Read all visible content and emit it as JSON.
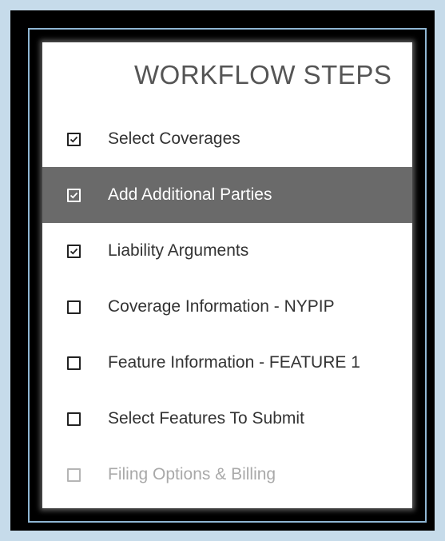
{
  "panel": {
    "title": "WORKFLOW STEPS"
  },
  "steps": [
    {
      "label": "Select Coverages",
      "checked": true,
      "active": false,
      "disabled": false,
      "icon": "checkbox-checked-icon"
    },
    {
      "label": "Add Additional Parties",
      "checked": true,
      "active": true,
      "disabled": false,
      "icon": "checkbox-checked-icon"
    },
    {
      "label": "Liability Arguments",
      "checked": true,
      "active": false,
      "disabled": false,
      "icon": "checkbox-checked-icon"
    },
    {
      "label": "Coverage Information - NYPIP",
      "checked": false,
      "active": false,
      "disabled": false,
      "icon": "checkbox-empty-icon"
    },
    {
      "label": "Feature Information - FEATURE 1",
      "checked": false,
      "active": false,
      "disabled": false,
      "icon": "checkbox-empty-icon"
    },
    {
      "label": "Select Features To Submit",
      "checked": false,
      "active": false,
      "disabled": false,
      "icon": "checkbox-empty-icon"
    },
    {
      "label": "Filing Options & Billing",
      "checked": false,
      "active": false,
      "disabled": true,
      "icon": "checkbox-empty-icon"
    }
  ],
  "colors": {
    "page_background": "#c6dbea",
    "frame": "#000000",
    "frame_border": "#8fb6d3",
    "active_row": "#6a6a6a",
    "text": "#333333",
    "disabled_text": "#a9a9a9"
  }
}
